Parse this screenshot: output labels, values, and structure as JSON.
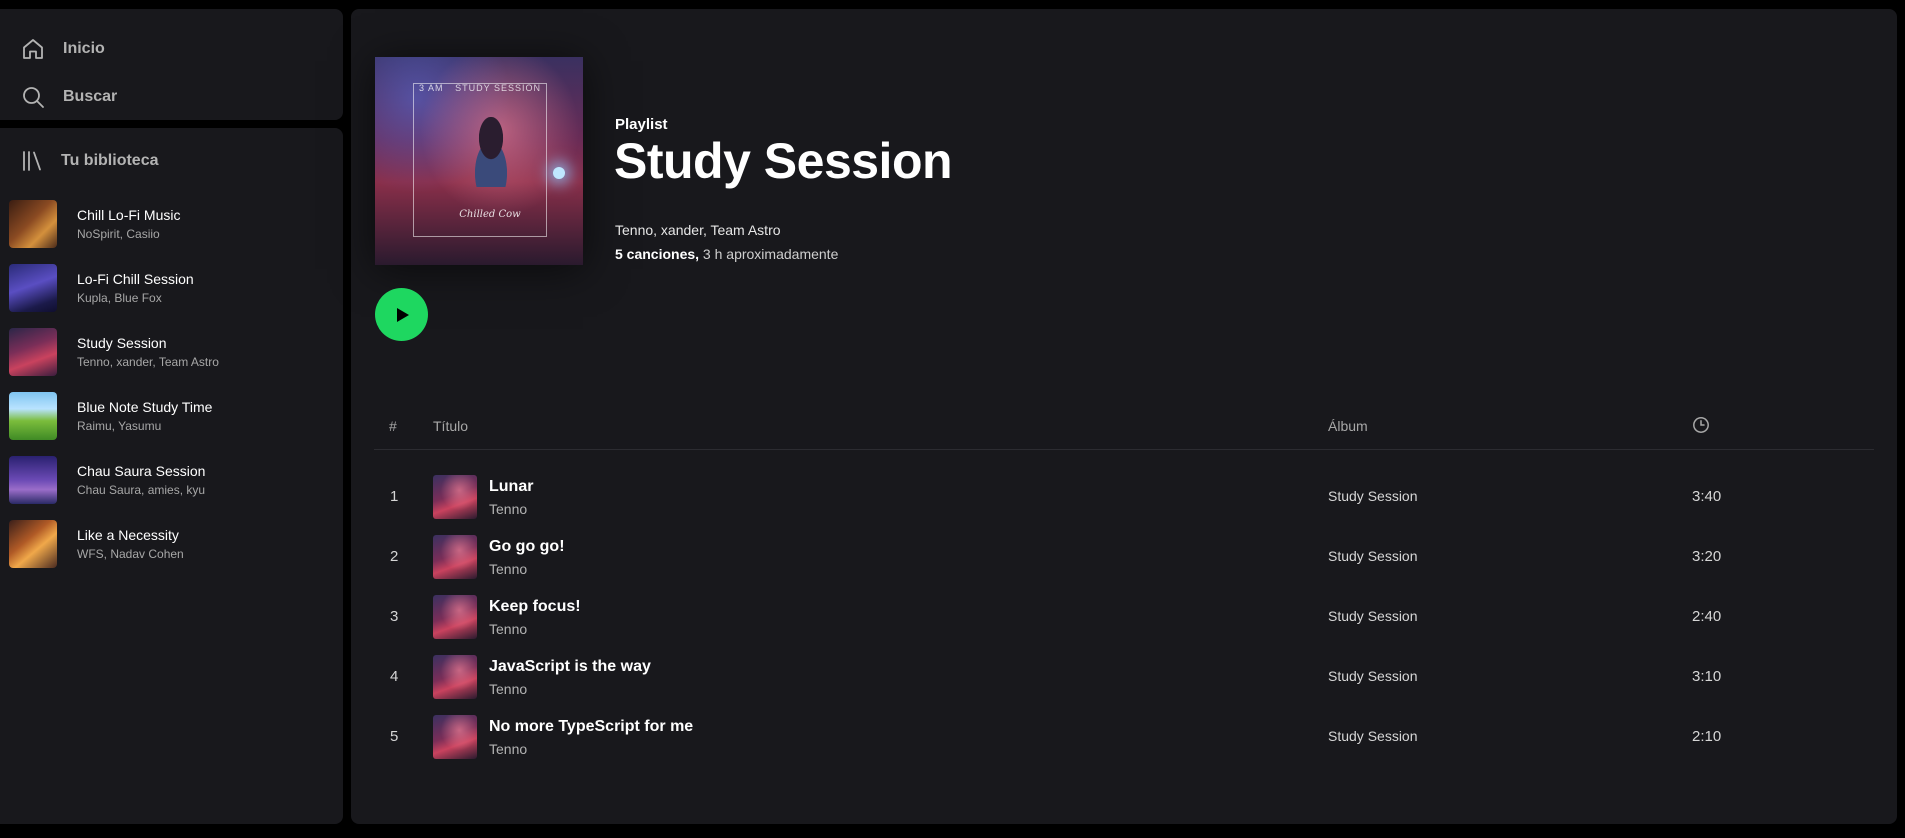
{
  "nav": {
    "home_label": "Inicio",
    "search_label": "Buscar",
    "home_icon": "home-icon",
    "search_icon": "search-icon"
  },
  "library": {
    "title": "Tu biblioteca",
    "icon": "library-icon",
    "items": [
      {
        "name": "Chill Lo-Fi Music",
        "artists": "NoSpirit, Casiio"
      },
      {
        "name": "Lo-Fi Chill Session",
        "artists": "Kupla, Blue Fox"
      },
      {
        "name": "Study Session",
        "artists": "Tenno, xander, Team Astro"
      },
      {
        "name": "Blue Note Study Time",
        "artists": "Raimu, Yasumu"
      },
      {
        "name": "Chau Saura Session",
        "artists": "Chau Saura, amies, kyu"
      },
      {
        "name": "Like a Necessity",
        "artists": "WFS, Nadav Cohen"
      }
    ]
  },
  "playlist": {
    "type": "Playlist",
    "title": "Study Session",
    "artists": "Tenno, xander, Team Astro",
    "song_count": "5 canciones,",
    "duration": " 3 h aproximadamente",
    "cover_text_left": "3 AM",
    "cover_text_right": "STUDY SESSION",
    "cover_script": "Chilled Cow"
  },
  "table": {
    "col_num": "#",
    "col_title": "Título",
    "col_album": "Álbum",
    "col_time_icon": "clock-icon",
    "rows": [
      {
        "num": "1",
        "title": "Lunar",
        "artist": "Tenno",
        "album": "Study Session",
        "duration": "3:40"
      },
      {
        "num": "2",
        "title": "Go go go!",
        "artist": "Tenno",
        "album": "Study Session",
        "duration": "3:20"
      },
      {
        "num": "3",
        "title": "Keep focus!",
        "artist": "Tenno",
        "album": "Study Session",
        "duration": "2:40"
      },
      {
        "num": "4",
        "title": "JavaScript is the way",
        "artist": "Tenno",
        "album": "Study Session",
        "duration": "3:10"
      },
      {
        "num": "5",
        "title": "No more TypeScript for me",
        "artist": "Tenno",
        "album": "Study Session",
        "duration": "2:10"
      }
    ]
  },
  "colors": {
    "accent": "#1ed760",
    "panel": "#18181c",
    "background": "#000000"
  }
}
